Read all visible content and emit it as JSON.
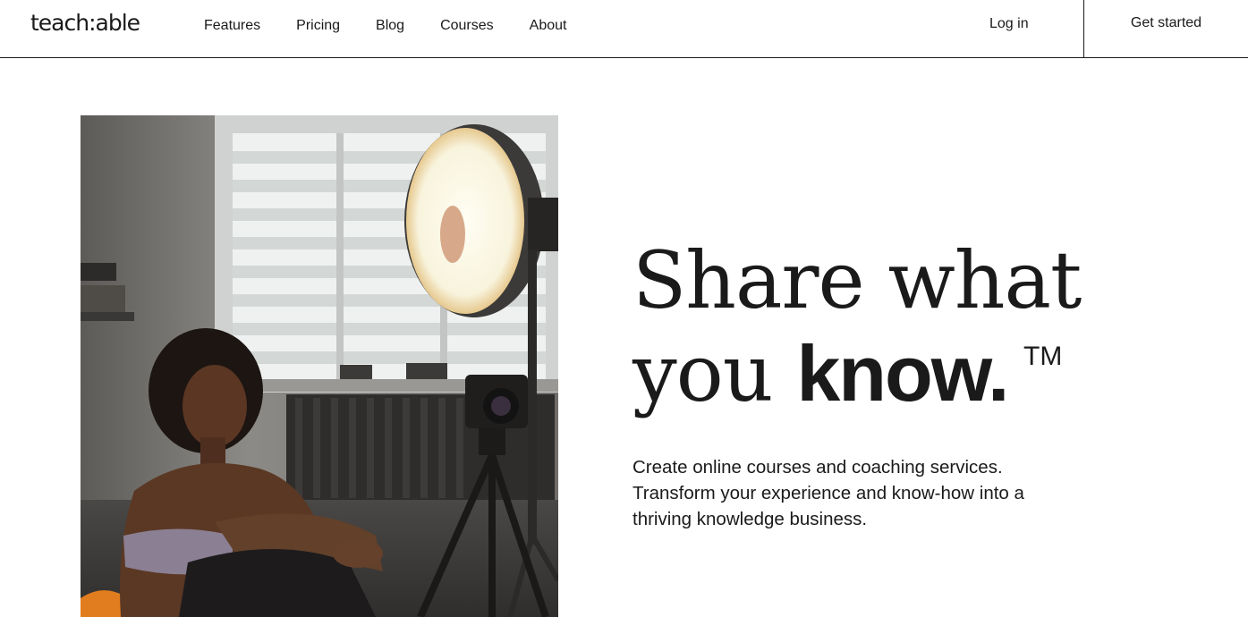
{
  "header": {
    "logo": "teach:able",
    "nav": [
      "Features",
      "Pricing",
      "Blog",
      "Courses",
      "About"
    ],
    "login_label": "Log in",
    "cta_label": "Get started"
  },
  "hero": {
    "headline_line1": "Share what",
    "headline_line2_prefix": "you ",
    "headline_line2_strong": "know.",
    "trademark": "TM",
    "subcopy_lines": [
      "Create online courses and coaching services.",
      "Transform your experience and know-how into a",
      "thriving knowledge business."
    ]
  },
  "colors": {
    "text": "#1a1a1a",
    "background": "#ffffff"
  }
}
